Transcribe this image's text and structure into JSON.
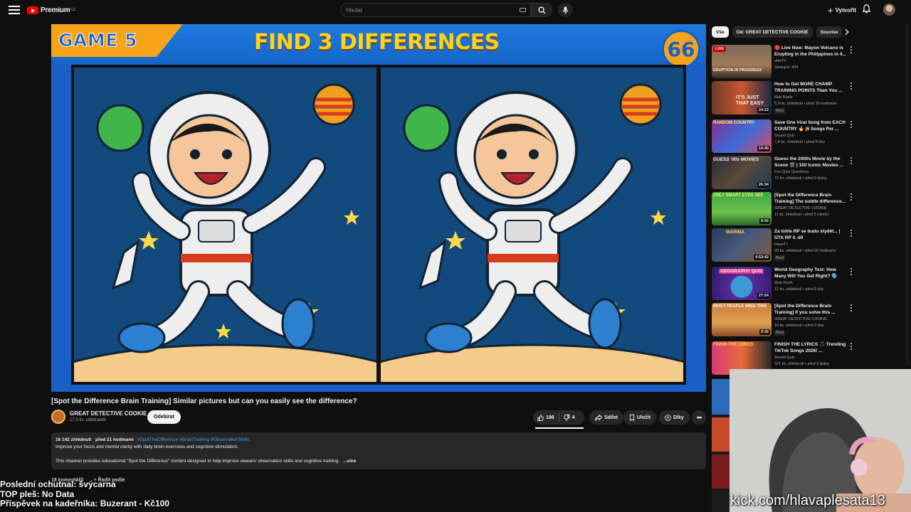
{
  "topbar": {
    "logo_text": "Premium",
    "logo_country": "CZ",
    "search_placeholder": "Hledat",
    "create_label": "Vytvořit"
  },
  "player": {
    "game_label": "GAME 5",
    "headline": "FIND 3 DIFFERENCES",
    "counter": "66"
  },
  "video": {
    "title": "[Spot the Difference Brain Training] Similar pictures but can you easily see the difference?",
    "channel_name": "GREAT DETECTIVE COOKIE",
    "channel_subs": "17,3 tis. odběratelů",
    "subscribe_label": "Odebírat",
    "likes": "198",
    "dislikes": "4",
    "share_label": "Sdílet",
    "save_label": "Uložit",
    "thanks_label": "Díky"
  },
  "description": {
    "views": "16 142 zhlédnutí",
    "age": "před 21 hodinami",
    "tags": "#SpotTheDifference #BrainTraining #ObservationSkills",
    "line1": "Improve your focus and mental clarity with daily brain exercises and cognitive stimulation.",
    "line2": "This channel provides educational \"Spot the Difference\" content designed to help improve viewers' observation skills and cognitive training.",
    "more_label": "...více"
  },
  "comments": {
    "count_label": "18 komentářů",
    "sort_label": "Řadit podle"
  },
  "overlay": {
    "line1": "Poslední ochutnal: švýcarna",
    "line2": "TOP pleš: No Data",
    "line3": "Příspěvek na kadeřníka: Buzerant - Kč100",
    "kick_url": "kick.com/hlavaplesata13"
  },
  "sidebar": {
    "chips": [
      "Vše",
      "Od: GREAT DETECTIVE COOKIE",
      "Souvise"
    ],
    "items": [
      {
        "title": "🔴 Live Now: Mayon Volcano is Erupting in the Philippines in 4...",
        "channel": "afarTV",
        "meta": "Sledující: 403",
        "duration": "",
        "thumb_text": "ERUPTION IN PROGRESS",
        "live": "LIVE",
        "badge": ""
      },
      {
        "title": "How to Get MORE CHAMP TRAINING POINTS Than You ...",
        "channel": "Nub Raids",
        "meta": "5,9 tis. zhlédnutí • před 16 hodinami",
        "duration": "24:23",
        "thumb_text": "IT'S JUST THAT EASY",
        "live": "",
        "badge": "Nový"
      },
      {
        "title": "Save One Viral Song from EACH COUNTRY 🔥 (6 Songs Per ...",
        "channel": "Sound Quiz",
        "meta": "7,4 tis. zhlédnutí • před 8 dny",
        "duration": "19:40",
        "thumb_text": "RANDOM COUNTRY",
        "live": "",
        "badge": ""
      },
      {
        "title": "Guess the 2000s Movie by the Scene 🎬 | 100 Iconic Movies ...",
        "channel": "Fun Quiz Questions",
        "meta": "72 tis. zhlédnutí • před 2 týdny",
        "duration": "26:34",
        "thumb_text": "GUESS '00s MOVIES",
        "live": "",
        "badge": ""
      },
      {
        "title": "[Spot the Difference Brain Training] The subtle difference...",
        "channel": "GREAT DETECTIVE COOKIE",
        "meta": "11 tis. zhlédnutí • před 5 měsíci",
        "duration": "9:32",
        "thumb_text": "ONLY SMART EYES SEE",
        "live": "",
        "badge": ""
      },
      {
        "title": "Za tohle RP se budu stydět... | GTA RP 4. díl",
        "channel": "HaseT+",
        "meta": "20 tis. zhlédnutí • před 20 hodinami",
        "duration": "4:53:42",
        "thumb_text": "MARINA",
        "live": "",
        "badge": "Nový"
      },
      {
        "title": "World Geography Test: How Many Will You Get Right? 🌎",
        "channel": "Quiz Rush",
        "meta": "12 tis. zhlédnutí • před 9 dny",
        "duration": "27:54",
        "thumb_text": "GEOGRAPHY QUIZ",
        "live": "",
        "badge": ""
      },
      {
        "title": "[Spot the Difference Brain Training] If you solve this ...",
        "channel": "GREAT DETECTIVE COOKIE",
        "meta": "19 tis. zhlédnutí • před 3 dny",
        "duration": "9:32",
        "thumb_text": "MOST PEOPLE MISS THIS",
        "live": "",
        "badge": "Nový"
      },
      {
        "title": "FINISH THE LYRICS 🎵 Trending TikTok Songs 2026! ...",
        "channel": "Sound Quiz",
        "meta": "321 tis. zhlédnutí • před 3 týdny",
        "duration": "",
        "thumb_text": "FINISH THE LYRICS",
        "live": "",
        "badge": ""
      }
    ]
  },
  "colors": {
    "bg": "#0f0f0f",
    "accent_red": "#ff0000",
    "link_blue": "#3ea6ff",
    "player_blue": "#1a5fc6",
    "game_orange": "#f7a41a"
  }
}
